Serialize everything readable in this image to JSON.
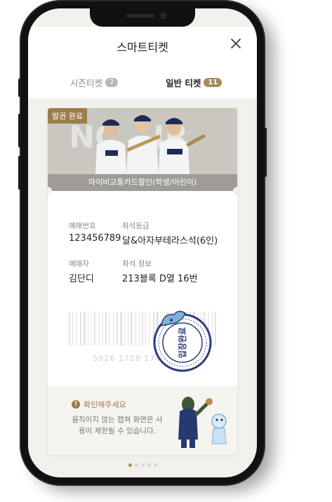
{
  "header": {
    "title": "스마트티켓"
  },
  "tabs": [
    {
      "label": "시즌티켓",
      "count": "7"
    },
    {
      "label": "일반 티켓",
      "count": "11"
    }
  ],
  "ticket": {
    "status_label": "발권 완료",
    "banner_caption": "마이비교통카드할인(학생/어린이)",
    "fields": {
      "booking_number_label": "예매번호",
      "booking_number": "123456789",
      "seat_grade_label": "좌석등급",
      "seat_grade": "달&아자부테라스석(6인)",
      "booker_label": "예매자",
      "booker": "김단디",
      "seat_info_label": "좌석 정보",
      "seat_info": "213블록 D열 16번"
    },
    "barcode_number": "5826 1728 1744 5730",
    "stamp_label": "입장완료"
  },
  "notice": {
    "title": "확인해주세요",
    "body": "움직이지 않는 캡쳐 화면은 사용이 제한될 수 있습니다."
  },
  "pagination": {
    "count": 5,
    "active": 0
  },
  "colors": {
    "accent": "#9b7d4c",
    "badge_gray": "#b9b9b9"
  }
}
